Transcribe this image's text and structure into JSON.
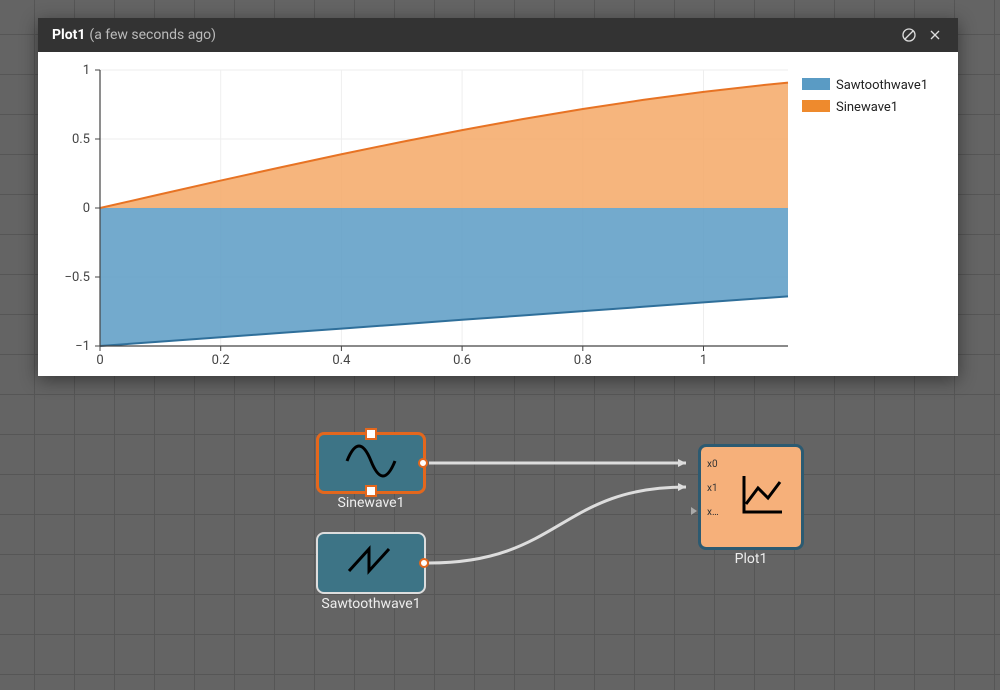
{
  "panel": {
    "title": "Plot1",
    "subtitle": "(a few seconds ago)"
  },
  "legend": {
    "items": [
      {
        "label": "Sawtoothwave1",
        "color": "#5a9bc4"
      },
      {
        "label": "Sinewave1",
        "color": "#ee8a2d"
      }
    ]
  },
  "axis": {
    "xticks": [
      "0",
      "0.2",
      "0.4",
      "0.6",
      "0.8",
      "1"
    ],
    "yticks": [
      "1",
      "0.5",
      "0",
      "-0.5",
      "-1"
    ]
  },
  "nodes": {
    "sine": {
      "label": "Sinewave1"
    },
    "saw": {
      "label": "Sawtoothwave1"
    },
    "plot": {
      "label": "Plot1"
    },
    "plot_inputs": {
      "x0": "x0",
      "x1": "x1",
      "xrest": "x…"
    }
  },
  "chart_data": {
    "type": "area",
    "title": "",
    "xlabel": "",
    "ylabel": "",
    "xlim": [
      0,
      1.14
    ],
    "ylim": [
      -1,
      1
    ],
    "x": [
      0,
      0.1,
      0.2,
      0.3,
      0.4,
      0.5,
      0.6,
      0.7,
      0.8,
      0.9,
      1.0,
      1.1,
      1.14
    ],
    "series": [
      {
        "name": "Sawtoothwave1",
        "color": "#5a9bc4",
        "stroke": "#2f6f9a",
        "values": [
          -1.0,
          -0.968,
          -0.937,
          -0.905,
          -0.874,
          -0.842,
          -0.81,
          -0.779,
          -0.747,
          -0.716,
          -0.684,
          -0.653,
          -0.64
        ]
      },
      {
        "name": "Sinewave1",
        "color": "#f4a866",
        "stroke": "#e77324",
        "values": [
          0.0,
          0.0998,
          0.1987,
          0.2955,
          0.3894,
          0.4794,
          0.5646,
          0.6442,
          0.7174,
          0.7833,
          0.8415,
          0.8912,
          0.9086
        ]
      }
    ],
    "grid": true,
    "legend_position": "right"
  }
}
